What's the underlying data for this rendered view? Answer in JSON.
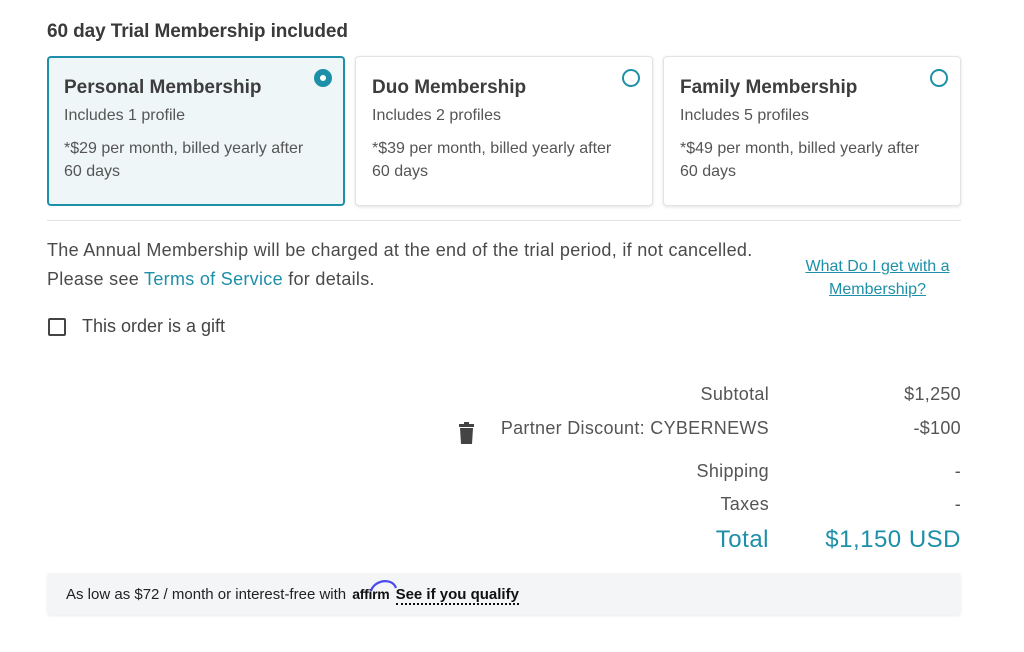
{
  "section_title": "60 day Trial Membership included",
  "plans": [
    {
      "name": "Personal Membership",
      "profiles": "Includes 1 profile",
      "price": "*$29 per month, billed yearly after 60 days",
      "selected": true
    },
    {
      "name": "Duo Membership",
      "profiles": "Includes 2 profiles",
      "price": "*$39 per month, billed yearly after 60 days",
      "selected": false
    },
    {
      "name": "Family Membership",
      "profiles": "Includes 5 profiles",
      "price": "*$49 per month, billed yearly after 60 days",
      "selected": false
    }
  ],
  "notice": {
    "before": "The Annual Membership will be charged at the end of the trial period, if not cancelled. Please see ",
    "link": "Terms of Service",
    "after": " for details."
  },
  "what_link": "What Do I get with a Membership?",
  "gift_label": "This order is a gift",
  "summary": {
    "subtotal_label": "Subtotal",
    "subtotal_value": "$1,250",
    "discount_label": "Partner Discount: CYBERNEWS",
    "discount_value": "-$100",
    "shipping_label": "Shipping",
    "shipping_value": "-",
    "taxes_label": "Taxes",
    "taxes_value": "-",
    "total_label": "Total",
    "total_value": "$1,150 USD"
  },
  "affirm": {
    "text": "As low as $72 / month or interest-free with",
    "logo": "affirm",
    "link": "See if you qualify"
  },
  "colors": {
    "accent": "#1e8fa8",
    "selected_bg": "#eef6f8"
  }
}
